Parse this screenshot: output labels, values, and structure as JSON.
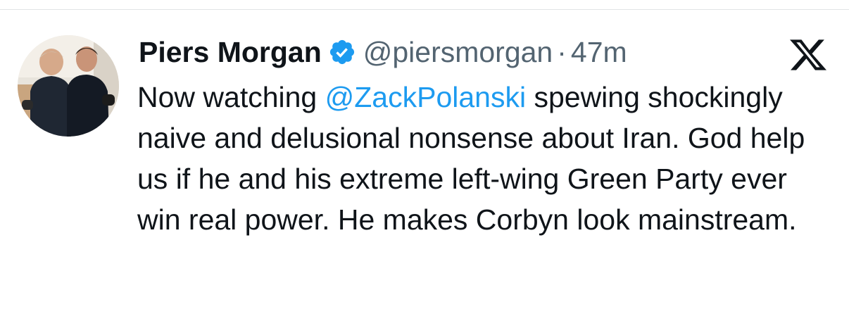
{
  "tweet": {
    "author_name": "Piers Morgan",
    "handle": "@piersmorgan",
    "separator": "·",
    "time": "47m",
    "text_before": "Now watching ",
    "mention": "@ZackPolanski",
    "text_after": " spewing shockingly naive and delusional nonsense about Iran. God help us if he and his extreme left-wing Green Party ever win real power. He makes Corbyn look mainstream."
  },
  "icons": {
    "verified": "verified-badge-icon",
    "platform": "x-logo-icon"
  },
  "colors": {
    "text": "#0f1419",
    "secondary": "#536471",
    "link": "#1d9bf0",
    "verified": "#1d9bf0"
  }
}
